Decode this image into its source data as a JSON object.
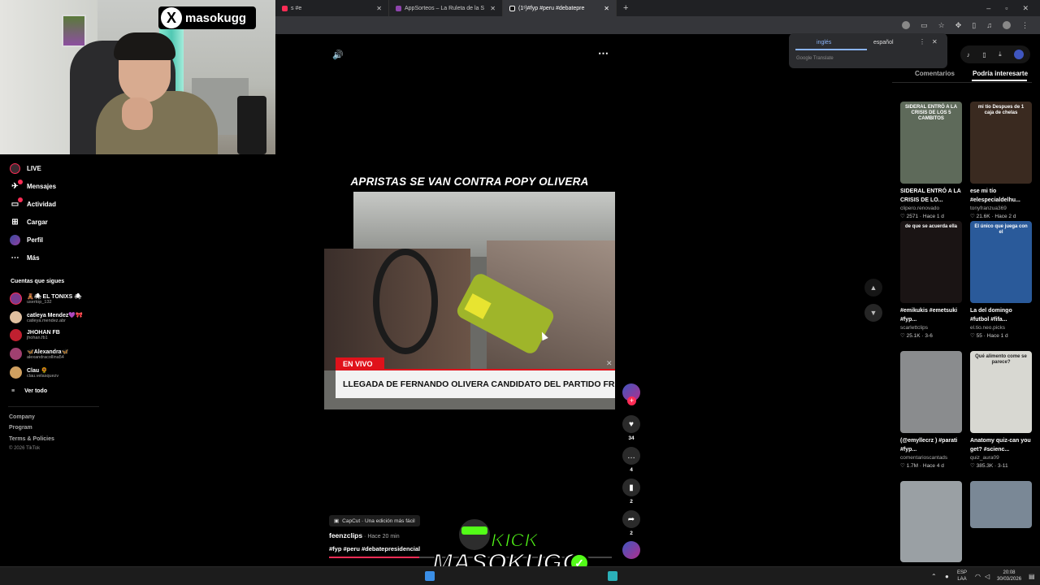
{
  "browser": {
    "tabs": [
      {
        "title": "s #e",
        "active": false,
        "color": "#fe2c55"
      },
      {
        "title": "AppSorteos – La Ruleta de la S",
        "active": false,
        "color": "#8e44ad"
      },
      {
        "title": "(1ˢ)#fyp #peru #debatepre",
        "active": true,
        "color": "#111111"
      }
    ],
    "newtab": "+",
    "win_min": "–",
    "win_max": "▫",
    "win_close": "✕"
  },
  "streamer": {
    "x_logo": "X",
    "name": "masokugg"
  },
  "sidebar": {
    "items": [
      {
        "label": "LIVE",
        "icon": "live-icon"
      },
      {
        "label": "Mensajes",
        "icon": "messages-icon"
      },
      {
        "label": "Actividad",
        "icon": "activity-icon"
      },
      {
        "label": "Cargar",
        "icon": "upload-icon"
      },
      {
        "label": "Perfil",
        "icon": "profile-icon"
      },
      {
        "label": "Más",
        "icon": "more-icon"
      }
    ],
    "following_header": "Cuentas que sigues",
    "following": [
      {
        "name": "🧸🕷 EL TONIXS 🕷",
        "handle": "usertop_132",
        "color": "#7a3b8c"
      },
      {
        "name": "catleya Mendez💜🎀",
        "handle": "catleya.mendez.abr",
        "color": "#e0c0a0"
      },
      {
        "name": "JHOHAN FB",
        "handle": "jhohan.fb1",
        "color": "#c02030"
      },
      {
        "name": "🦋Alexandra🦋",
        "handle": "alexandracollina54",
        "color": "#a04070"
      },
      {
        "name": "Clau 🌻",
        "handle": "clau.velasquezv",
        "color": "#d0a060"
      }
    ],
    "ver_todo": "Ver todo",
    "footer_links": [
      "Company",
      "Program",
      "Terms & Policies"
    ],
    "copyright": "© 2026 TikTok"
  },
  "video": {
    "title": "APRISTAS SE VAN CONTRA POPY OLIVERA",
    "live_badge": "EN VIVO",
    "lower_third": "LLEGADA DE FERNANDO OLIVERA CANDIDATO DEL PARTIDO FRENTE DE LA ES",
    "close": "✕",
    "likes": "34",
    "comments": "4",
    "saves": "2",
    "shares": "2",
    "capcut": "CapCut · Una edición más fácil",
    "author": "feenzclips",
    "time": " · Hace 20 min",
    "tags": "#fyp #peru #debatepresidencial",
    "progress": 0.32
  },
  "translate": {
    "lang_from": "inglés",
    "lang_to": "español",
    "brand": "Google Translate",
    "more": "⋮",
    "close": "✕"
  },
  "right_panel": {
    "tabs": [
      "Comentarios",
      "Podría interesarte"
    ],
    "cards": [
      {
        "thumb_text": "SIDERAL ENTRÓ A LA CRISIS DE LOS 5 CAMBITOS",
        "caption": "SIDERAL ENTRÓ A LA CRISIS DE LO...",
        "author": "clipero.renovado",
        "likes": "2571",
        "age": "Hace 1 d",
        "bg": "#5e6a5a"
      },
      {
        "thumb_text": "mi tío Despues de 1 caja de chelas",
        "caption": "ese mi tío #elespecialdelhu...",
        "author": "tonyfranzua369",
        "likes": "21.6K",
        "age": "Hace 2 d",
        "bg": "#3a2a20"
      },
      {
        "thumb_text": "de que se acuerda ella",
        "caption": "#emikukis #emetsuki #fyp...",
        "author": "scarlettclips",
        "likes": "25.1K",
        "age": "3-6",
        "bg": "#1a1414"
      },
      {
        "thumb_text": "El único que juega con el",
        "caption": "La del domingo #futbol #fifa...",
        "author": "el.tio.neo.picks",
        "likes": "55",
        "age": "Hace 1 d",
        "bg": "#2a5a9a"
      },
      {
        "thumb_text": "",
        "caption": "(@emyllecrz ) #parati #fyp...",
        "author": "comentarioscantads",
        "likes": "1.7M",
        "age": "Hace 4 d",
        "bg": "#8a8c8e"
      },
      {
        "thumb_text": "Qué alimento come se parece?",
        "caption": "Anatomy quiz-can you get? #scienc...",
        "author": "quiz_aura09",
        "likes": "385.3K",
        "age": "3-11",
        "bg": "#d8d8d2"
      },
      {
        "thumb_text": "",
        "caption": "",
        "author": "",
        "likes": "",
        "age": "",
        "bg": "#9aa0a4"
      },
      {
        "thumb_text": "",
        "caption": "",
        "author": "",
        "likes": "",
        "age": "",
        "bg": "#7a8896"
      }
    ]
  },
  "overlay": {
    "kick": "KICK",
    "name": "MASOKUGG",
    "check": "✓"
  },
  "taskbar": {
    "lang": "ESP",
    "region": "LAA",
    "time": "20:08",
    "date": "30/03/2026"
  }
}
